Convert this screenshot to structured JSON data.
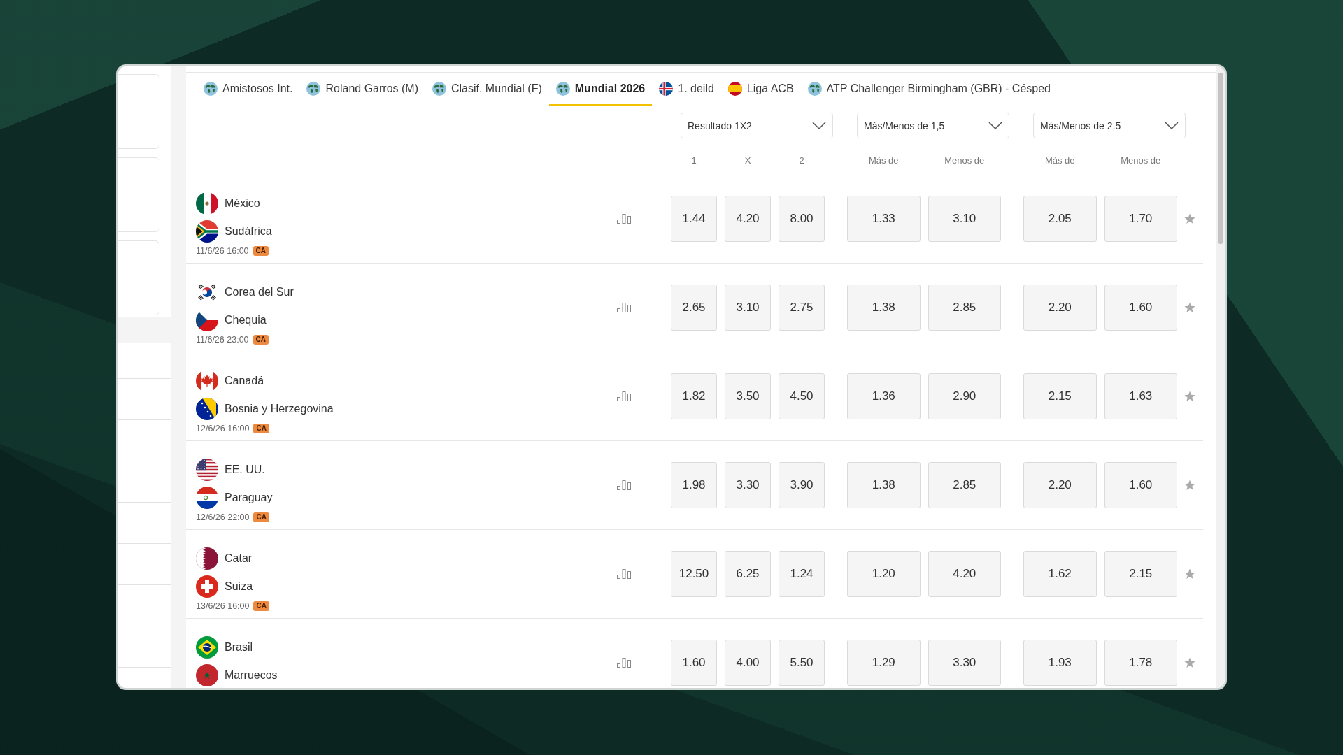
{
  "tabs": [
    {
      "label": "Amistosos Int.",
      "selected": false
    },
    {
      "label": "Roland Garros (M)",
      "selected": false
    },
    {
      "label": "Clasif. Mundial (F)",
      "selected": false
    },
    {
      "label": "Mundial 2026",
      "selected": true
    },
    {
      "label": "1. deild",
      "selected": false
    },
    {
      "label": "Liga ACB",
      "selected": false
    },
    {
      "label": "ATP Challenger Birmingham (GBR) - Césped",
      "selected": false
    }
  ],
  "markets": [
    {
      "label": "Resultado 1X2",
      "columns": [
        "1",
        "X",
        "2"
      ]
    },
    {
      "label": "Más/Menos de 1,5",
      "columns": [
        "Más de",
        "Menos de"
      ]
    },
    {
      "label": "Más/Menos de 2,5",
      "columns": [
        "Más de",
        "Menos de"
      ]
    }
  ],
  "matches": [
    {
      "teams": [
        "México",
        "Sudáfrica"
      ],
      "time": "11/6/26 16:00",
      "badge": "CA",
      "odds": [
        [
          "1.44",
          "4.20",
          "8.00"
        ],
        [
          "1.33",
          "3.10"
        ],
        [
          "2.05",
          "1.70"
        ]
      ]
    },
    {
      "teams": [
        "Corea del Sur",
        "Chequia"
      ],
      "time": "11/6/26 23:00",
      "badge": "CA",
      "odds": [
        [
          "2.65",
          "3.10",
          "2.75"
        ],
        [
          "1.38",
          "2.85"
        ],
        [
          "2.20",
          "1.60"
        ]
      ]
    },
    {
      "teams": [
        "Canadá",
        "Bosnia y Herzegovina"
      ],
      "time": "12/6/26 16:00",
      "badge": "CA",
      "odds": [
        [
          "1.82",
          "3.50",
          "4.50"
        ],
        [
          "1.36",
          "2.90"
        ],
        [
          "2.15",
          "1.63"
        ]
      ]
    },
    {
      "teams": [
        "EE. UU.",
        "Paraguay"
      ],
      "time": "12/6/26 22:00",
      "badge": "CA",
      "odds": [
        [
          "1.98",
          "3.30",
          "3.90"
        ],
        [
          "1.38",
          "2.85"
        ],
        [
          "2.20",
          "1.60"
        ]
      ]
    },
    {
      "teams": [
        "Catar",
        "Suiza"
      ],
      "time": "13/6/26 16:00",
      "badge": "CA",
      "odds": [
        [
          "12.50",
          "6.25",
          "1.24"
        ],
        [
          "1.20",
          "4.20"
        ],
        [
          "1.62",
          "2.15"
        ]
      ]
    },
    {
      "teams": [
        "Brasil",
        "Marruecos"
      ],
      "odds": [
        [
          "1.60",
          "4.00",
          "5.50"
        ],
        [
          "1.29",
          "3.30"
        ],
        [
          "1.93",
          "1.78"
        ]
      ]
    }
  ]
}
